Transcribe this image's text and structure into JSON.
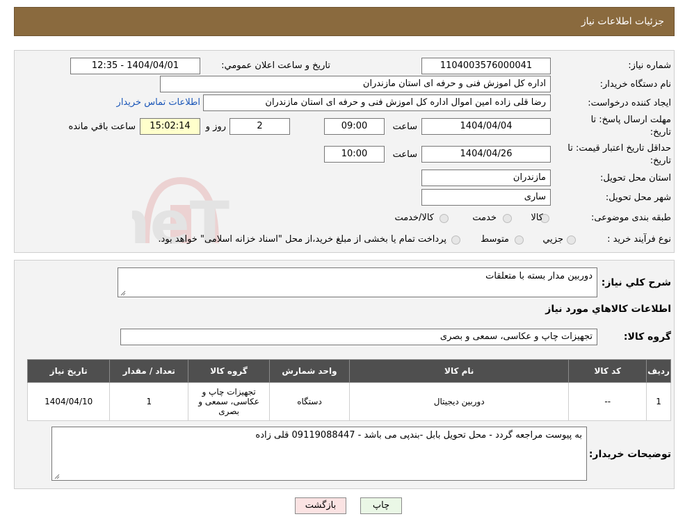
{
  "header": {
    "title": "جزئیات اطلاعات نیاز"
  },
  "info": {
    "need_number_label": "شماره نیاز:",
    "need_number": "1104003576000041",
    "announce_label": "تاریخ و ساعت اعلان عمومي:",
    "announce_value": "1404/04/01 - 12:35",
    "buyer_org_label": "نام دستگاه خریدار:",
    "buyer_org": "اداره کل اموزش فنی و حرفه ای استان مازندران",
    "creator_label": "ایجاد کننده درخواست:",
    "creator": "رضا قلی زاده امین اموال اداره کل اموزش فنی و حرفه ای استان مازندران",
    "contact_link": "اطلاعات تماس خریدار",
    "deadline_label_1": "مهلت ارسال پاسخ: تا",
    "deadline_label_2": "تاریخ:",
    "deadline_date": "1404/04/04",
    "time_label": "ساعت",
    "deadline_time": "09:00",
    "days": "2",
    "days_label": "روز و",
    "remaining": "15:02:14",
    "remaining_label": "ساعت باقي مانده",
    "validity_label_1": "حداقل تاریخ اعتبار قیمت: تا",
    "validity_label_2": "تاریخ:",
    "validity_date": "1404/04/26",
    "validity_time": "10:00",
    "province_label": "استان محل تحویل:",
    "province": "مازندران",
    "city_label": "شهر محل تحویل:",
    "city": "ساری",
    "category_label": "طبقه بندی موضوعی:",
    "category_options": [
      "کالا",
      "خدمت",
      "کالا/خدمت"
    ],
    "process_label": "نوع فرآیند خرید :",
    "process_options": [
      "جزيي",
      "متوسط"
    ],
    "process_note": "پرداخت تمام یا بخشی از مبلغ خرید،از محل \"اسناد خزانه اسلامی\" خواهد بود."
  },
  "summary": {
    "desc_label": "شرح كلي نياز:",
    "desc": "دوربین مدار بسته با متعلقات",
    "goods_title": "اطلاعات كالاهاي مورد نياز",
    "group_label": "گروه کالا:",
    "group": "تجهیزات چاپ و عکاسی، سمعی و بصری",
    "table": {
      "headers": [
        "رديف",
        "کد کالا",
        "نام کالا",
        "واحد شمارش",
        "گروه کالا",
        "تعداد / مقدار",
        "تاریخ نیاز"
      ],
      "rows": [
        [
          "1",
          "--",
          "دوربین دیجیتال",
          "دستگاه",
          "تجهیزات چاپ و عکاسی، سمعی و بصری",
          "1",
          "1404/04/10"
        ]
      ]
    },
    "notes_label": "توضیحات خریدار:",
    "notes": "به پیوست مراجعه گردد - محل تحویل بابل -بندپی می باشد - 09119088447 قلی زاده"
  },
  "buttons": {
    "print": "چاپ",
    "back": "بازگشت"
  },
  "watermark": {
    "brand": "AriaTender.neT"
  },
  "colors": {
    "header_bg": "#8a6a3e",
    "table_header_bg": "#4f4f4f",
    "remaining_bg": "#ffffcc",
    "link": "#1a56b8",
    "print_btn_bg": "#eaf7e6",
    "back_btn_bg": "#fbe3e3"
  }
}
